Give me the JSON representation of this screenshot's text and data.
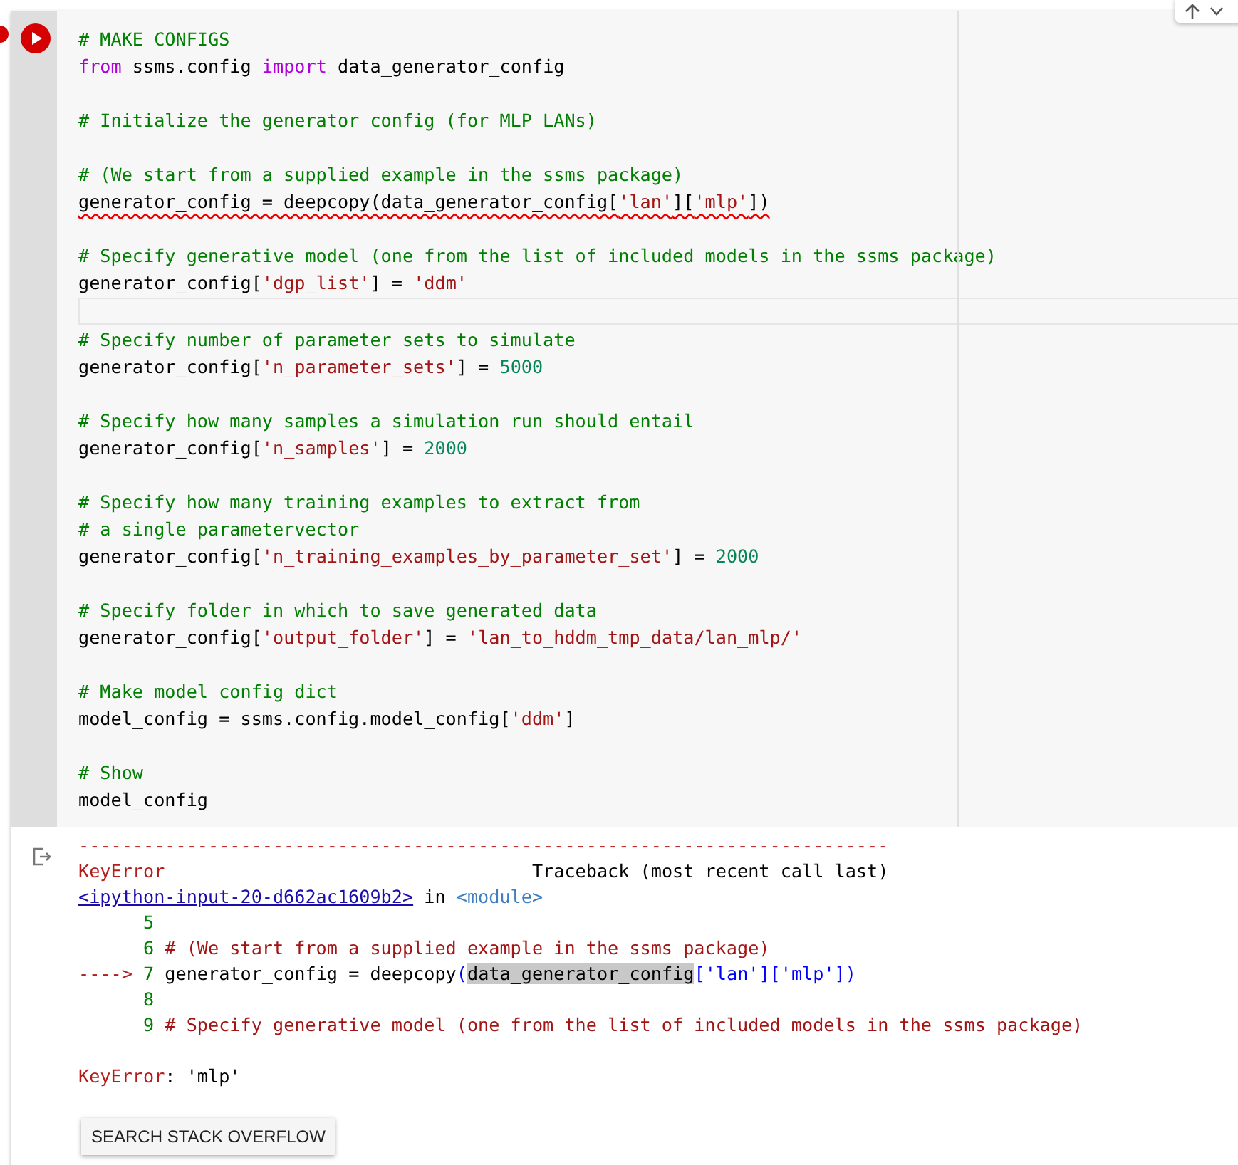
{
  "code_lines": [
    {
      "kind": "code",
      "segments": [
        {
          "kind": "comment",
          "text": "# MAKE CONFIGS"
        }
      ]
    },
    {
      "kind": "code",
      "segments": [
        {
          "kind": "keyword",
          "text": "from"
        },
        {
          "kind": "plain",
          "text": " ssms.config "
        },
        {
          "kind": "keyword",
          "text": "import"
        },
        {
          "kind": "plain",
          "text": " data_generator_config"
        }
      ]
    },
    {
      "kind": "blank"
    },
    {
      "kind": "code",
      "segments": [
        {
          "kind": "comment",
          "text": "# Initialize the generator config (for MLP LANs)"
        }
      ]
    },
    {
      "kind": "blank"
    },
    {
      "kind": "code",
      "segments": [
        {
          "kind": "comment",
          "text": "# (We start from a supplied example in the ssms package)"
        }
      ]
    },
    {
      "kind": "code",
      "squiggle": true,
      "segments": [
        {
          "kind": "plain",
          "text": "generator_config = deepcopy(data_generator_config["
        },
        {
          "kind": "string",
          "text": "'lan'"
        },
        {
          "kind": "plain",
          "text": "]["
        },
        {
          "kind": "string",
          "text": "'mlp'"
        },
        {
          "kind": "plain",
          "text": "])"
        }
      ]
    },
    {
      "kind": "blank"
    },
    {
      "kind": "code",
      "segments": [
        {
          "kind": "comment",
          "text": "# Specify generative model (one from the list of included models in the ssms package)"
        }
      ]
    },
    {
      "kind": "code",
      "segments": [
        {
          "kind": "plain",
          "text": "generator_config["
        },
        {
          "kind": "string",
          "text": "'dgp_list'"
        },
        {
          "kind": "plain",
          "text": "] = "
        },
        {
          "kind": "string",
          "text": "'ddm'"
        }
      ]
    },
    {
      "kind": "blank",
      "current": true
    },
    {
      "kind": "code",
      "segments": [
        {
          "kind": "comment",
          "text": "# Specify number of parameter sets to simulate"
        }
      ]
    },
    {
      "kind": "code",
      "segments": [
        {
          "kind": "plain",
          "text": "generator_config["
        },
        {
          "kind": "string",
          "text": "'n_parameter_sets'"
        },
        {
          "kind": "plain",
          "text": "] = "
        },
        {
          "kind": "number",
          "text": "5000"
        }
      ]
    },
    {
      "kind": "blank"
    },
    {
      "kind": "code",
      "segments": [
        {
          "kind": "comment",
          "text": "# Specify how many samples a simulation run should entail"
        }
      ]
    },
    {
      "kind": "code",
      "segments": [
        {
          "kind": "plain",
          "text": "generator_config["
        },
        {
          "kind": "string",
          "text": "'n_samples'"
        },
        {
          "kind": "plain",
          "text": "] = "
        },
        {
          "kind": "number",
          "text": "2000"
        }
      ]
    },
    {
      "kind": "blank"
    },
    {
      "kind": "code",
      "segments": [
        {
          "kind": "comment",
          "text": "# Specify how many training examples to extract from"
        }
      ]
    },
    {
      "kind": "code",
      "segments": [
        {
          "kind": "comment",
          "text": "# a single parametervector"
        }
      ]
    },
    {
      "kind": "code",
      "segments": [
        {
          "kind": "plain",
          "text": "generator_config["
        },
        {
          "kind": "string",
          "text": "'n_training_examples_by_parameter_set'"
        },
        {
          "kind": "plain",
          "text": "] = "
        },
        {
          "kind": "number",
          "text": "2000"
        }
      ]
    },
    {
      "kind": "blank"
    },
    {
      "kind": "code",
      "segments": [
        {
          "kind": "comment",
          "text": "# Specify folder in which to save generated data"
        }
      ]
    },
    {
      "kind": "code",
      "segments": [
        {
          "kind": "plain",
          "text": "generator_config["
        },
        {
          "kind": "string",
          "text": "'output_folder'"
        },
        {
          "kind": "plain",
          "text": "] = "
        },
        {
          "kind": "string",
          "text": "'lan_to_hddm_tmp_data/lan_mlp/'"
        }
      ]
    },
    {
      "kind": "blank"
    },
    {
      "kind": "code",
      "segments": [
        {
          "kind": "comment",
          "text": "# Make model config dict"
        }
      ]
    },
    {
      "kind": "code",
      "segments": [
        {
          "kind": "plain",
          "text": "model_config = ssms.config.model_config["
        },
        {
          "kind": "string",
          "text": "'ddm'"
        },
        {
          "kind": "plain",
          "text": "]"
        }
      ]
    },
    {
      "kind": "blank"
    },
    {
      "kind": "code",
      "segments": [
        {
          "kind": "comment",
          "text": "# Show"
        }
      ]
    },
    {
      "kind": "code",
      "segments": [
        {
          "kind": "plain",
          "text": "model_config"
        }
      ]
    }
  ],
  "output_lines": [
    {
      "kind": "text",
      "segments": [
        {
          "kind": "error",
          "text": "---------------------------------------------------------------------------"
        }
      ]
    },
    {
      "kind": "text",
      "segments": [
        {
          "kind": "error",
          "text": "KeyError"
        },
        {
          "kind": "plain",
          "text": "                                  Traceback (most recent call last)"
        }
      ]
    },
    {
      "kind": "text",
      "segments": [
        {
          "kind": "link",
          "text": "<ipython-input-20-d662ac1609b2>"
        },
        {
          "kind": "plain",
          "text": " in "
        },
        {
          "kind": "module",
          "text": "<module>"
        }
      ]
    },
    {
      "kind": "text",
      "segments": [
        {
          "kind": "lineno",
          "text": "      5"
        }
      ]
    },
    {
      "kind": "text",
      "segments": [
        {
          "kind": "lineno",
          "text": "      6"
        },
        {
          "kind": "tbcomment",
          "text": " # (We start from a supplied example in the ssms package)"
        }
      ]
    },
    {
      "kind": "text",
      "segments": [
        {
          "kind": "error",
          "text": "----> "
        },
        {
          "kind": "lineno",
          "text": "7"
        },
        {
          "kind": "plain",
          "text": " generator_config = deepcopy"
        },
        {
          "kind": "tbstring",
          "text": "("
        },
        {
          "kind": "highlight",
          "text": "data_generator_config"
        },
        {
          "kind": "tbstring",
          "text": "['lan']['mlp'])"
        }
      ]
    },
    {
      "kind": "text",
      "segments": [
        {
          "kind": "lineno",
          "text": "      8"
        }
      ]
    },
    {
      "kind": "text",
      "segments": [
        {
          "kind": "lineno",
          "text": "      9"
        },
        {
          "kind": "tbcomment",
          "text": " # Specify generative model (one from the list of included models in the ssms package)"
        }
      ]
    },
    {
      "kind": "blank"
    },
    {
      "kind": "text",
      "segments": [
        {
          "kind": "error",
          "text": "KeyError"
        },
        {
          "kind": "plain",
          "text": ": 'mlp'"
        }
      ]
    }
  ],
  "button": "SEARCH STACK OVERFLOW"
}
